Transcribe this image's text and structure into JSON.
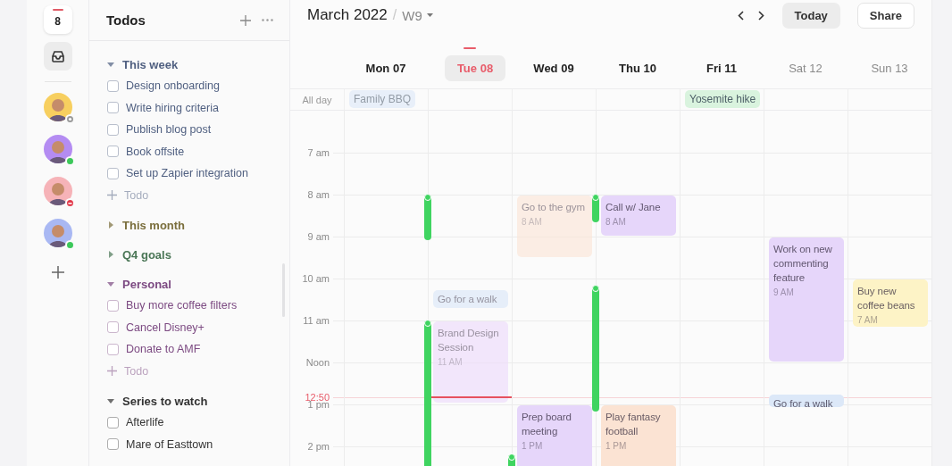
{
  "rail": {
    "calendar_day": "8",
    "people": [
      {
        "color": "#f7cf5f",
        "kind": "away"
      },
      {
        "color": "#b48cf2",
        "kind": "online"
      },
      {
        "color": "#f6b3b8",
        "kind": "busy"
      },
      {
        "color": "#a9b8f3",
        "kind": "online"
      }
    ]
  },
  "todos": {
    "title": "Todos",
    "sections": [
      {
        "title": "This week",
        "color": "#4f5f80",
        "expanded": true,
        "items": [
          {
            "label": "Design onboarding",
            "checked": false
          },
          {
            "label": "Write hiring criteria",
            "checked": false
          },
          {
            "label": "Publish blog post",
            "checked": false
          },
          {
            "label": "Book offsite",
            "checked": false
          },
          {
            "label": "Set up Zapier integration",
            "checked": false
          }
        ],
        "add_label": "Todo"
      },
      {
        "title": "This month",
        "color": "#7a6e3c",
        "expanded": false
      },
      {
        "title": "Q4 goals",
        "color": "#4a7656",
        "expanded": false
      },
      {
        "title": "Personal",
        "color": "#7c4a82",
        "expanded": true,
        "items": [
          {
            "label": "Buy more coffee filters",
            "checked": false
          },
          {
            "label": "Cancel Disney+",
            "checked": false
          },
          {
            "label": "Donate to AMF",
            "checked": false
          }
        ],
        "add_label": "Todo"
      },
      {
        "title": "Series to watch",
        "color": "#333333",
        "expanded": true,
        "items": [
          {
            "label": "Afterlife",
            "checked": false
          },
          {
            "label": "Mare of Easttown",
            "checked": false
          }
        ]
      }
    ]
  },
  "calendar": {
    "month": "March 2022",
    "separator": "/",
    "week": "W9",
    "today_button": "Today",
    "share_button": "Share",
    "all_day_label": "All day",
    "time_labels": [
      {
        "text": "7 am",
        "kind": "hour"
      },
      {
        "text": "8 am",
        "kind": "hour"
      },
      {
        "text": "9 am",
        "kind": "hour"
      },
      {
        "text": "10 am",
        "kind": "hour"
      },
      {
        "text": "11 am",
        "kind": "hour"
      },
      {
        "text": "Noon",
        "kind": "hour"
      },
      {
        "text": "12:50",
        "kind": "now"
      },
      {
        "text": "1 pm",
        "kind": "hour"
      },
      {
        "text": "2 pm",
        "kind": "hour"
      }
    ],
    "days": [
      {
        "label": "Mon 07",
        "today": false,
        "weekend": false,
        "all_day": [
          {
            "title": "Family BBQ",
            "color": "#dce8f8",
            "dimmed": true
          }
        ]
      },
      {
        "label": "Tue 08",
        "today": true,
        "weekend": false,
        "events": [
          {
            "title": "Go for a walk",
            "color": "#dce8f8",
            "dimmed": true
          },
          {
            "title": "Brand Design Session",
            "time": "11 AM",
            "color": "#eedcfb",
            "dimmed": true
          }
        ]
      },
      {
        "label": "Wed 09",
        "today": false,
        "weekend": false,
        "events": [
          {
            "title": "Go to the gym",
            "time": "8 AM",
            "color": "#fbe6d8",
            "dimmed": true
          },
          {
            "title": "Prep board meeting",
            "time": "1 PM",
            "color": "#e6d6fa",
            "dimmed": false
          }
        ]
      },
      {
        "label": "Thu 10",
        "today": false,
        "weekend": false,
        "events": [
          {
            "title": "Call w/ Jane",
            "time": "8 AM",
            "color": "#e6d6fa",
            "dimmed": false
          },
          {
            "title": "Play fantasy football",
            "time": "1 PM",
            "color": "#fbe3d3",
            "dimmed": false
          }
        ]
      },
      {
        "label": "Fri 11",
        "today": false,
        "weekend": false,
        "all_day": [
          {
            "title": "Yosemite hike",
            "color": "#d9f3de",
            "dimmed": false
          }
        ]
      },
      {
        "label": "Sat 12",
        "today": false,
        "weekend": true,
        "events": [
          {
            "title": "Work on new commenting feature",
            "time": "9 AM",
            "color": "#e6d6fa",
            "dimmed": false
          },
          {
            "title": "Go for a walk",
            "color": "#dce8f8",
            "dimmed": false
          }
        ]
      },
      {
        "label": "Sun 13",
        "today": false,
        "weekend": true,
        "events": [
          {
            "title": "Buy new coffee beans",
            "time": "7 AM",
            "color": "#fdf3c6",
            "dimmed": false
          }
        ]
      }
    ]
  }
}
